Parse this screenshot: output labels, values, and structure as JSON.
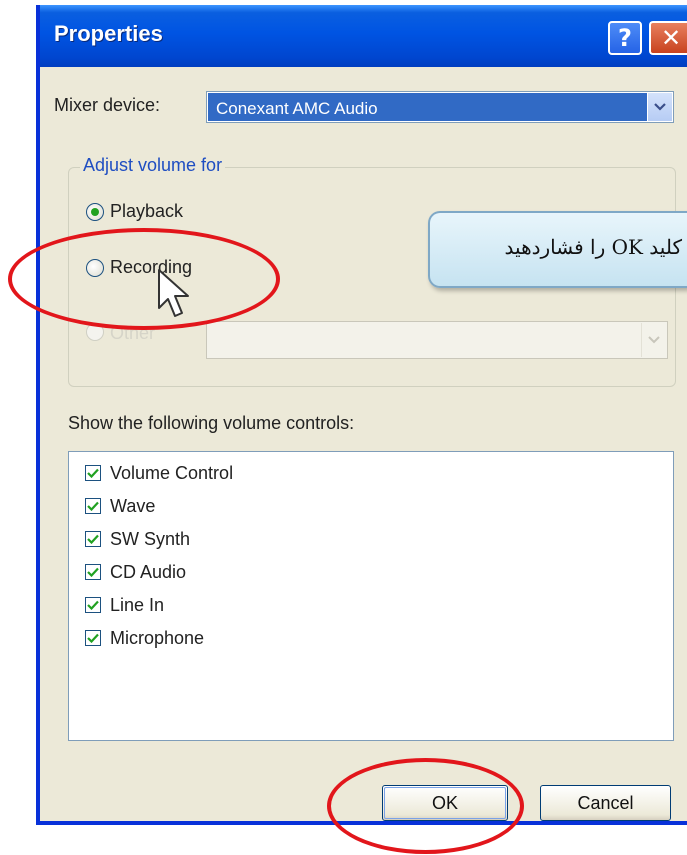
{
  "window": {
    "title": "Properties",
    "help_glyph": "?",
    "close_glyph": "✕"
  },
  "mixer": {
    "label": "Mixer device:",
    "selected": "Conexant AMC Audio"
  },
  "adjust_group": {
    "legend": "Adjust volume for",
    "options": [
      {
        "label": "Playback",
        "selected": true,
        "enabled": true
      },
      {
        "label": "Recording",
        "selected": false,
        "enabled": true
      },
      {
        "label": "Other",
        "selected": false,
        "enabled": false
      }
    ]
  },
  "controls": {
    "label": "Show the following volume controls:",
    "items": [
      {
        "label": "Volume Control",
        "checked": true
      },
      {
        "label": "Wave",
        "checked": true
      },
      {
        "label": "SW Synth",
        "checked": true
      },
      {
        "label": "CD Audio",
        "checked": true
      },
      {
        "label": "Line In",
        "checked": true
      },
      {
        "label": "Microphone",
        "checked": true
      }
    ]
  },
  "buttons": {
    "ok": "OK",
    "cancel": "Cancel"
  },
  "annotation": {
    "tooltip_text": "کلید OK را فشاردهید",
    "highlight_color": "#e2161b"
  },
  "colors": {
    "titlebar": "#0054e3",
    "dialog_bg": "#ece9d8",
    "selection": "#316ac5",
    "check": "#21a121"
  }
}
